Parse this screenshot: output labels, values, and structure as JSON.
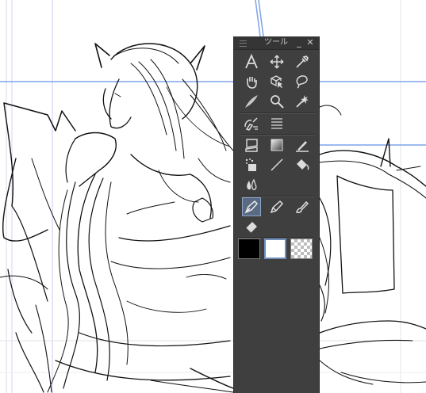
{
  "panel": {
    "title": "ツール",
    "minimize_label": "_",
    "close_label": "✕"
  },
  "tools": [
    {
      "name": "text-tool",
      "icon": "text-icon"
    },
    {
      "name": "move-tool",
      "icon": "move-arrows-icon"
    },
    {
      "name": "eyedropper-tool",
      "icon": "eyedropper-icon"
    },
    {
      "name": "hand-tool",
      "icon": "hand-icon"
    },
    {
      "name": "object-tool",
      "icon": "object-cube-icon"
    },
    {
      "name": "lasso-tool",
      "icon": "lasso-icon"
    },
    {
      "name": "ruler-tool",
      "icon": "ruler-icon"
    },
    {
      "name": "zoom-tool",
      "icon": "magnifier-icon"
    },
    {
      "name": "auto-select-tool",
      "icon": "magic-wand-icon"
    },
    {
      "name": "balloon-tool",
      "icon": "speech-pen-icon"
    },
    {
      "name": "speed-lines-tool",
      "icon": "parallel-lines-icon"
    },
    {
      "name": "frame-tool",
      "icon": "frame-border-icon"
    },
    {
      "name": "gradient-tool",
      "icon": "gradient-icon"
    },
    {
      "name": "correct-line-tool",
      "icon": "correct-line-icon"
    },
    {
      "name": "decoration-tool",
      "icon": "decoration-icon"
    },
    {
      "name": "figure-tool",
      "icon": "line-figure-icon"
    },
    {
      "name": "fill-tool",
      "icon": "bucket-fill-icon"
    },
    {
      "name": "blend-tool",
      "icon": "blend-drops-icon"
    },
    {
      "name": "pen-tool",
      "icon": "pen-nib-icon",
      "selected": true
    },
    {
      "name": "pencil-tool",
      "icon": "pencil-icon"
    },
    {
      "name": "brush-tool",
      "icon": "brush-icon"
    },
    {
      "name": "eraser-tool",
      "icon": "eraser-icon"
    }
  ],
  "colors": {
    "main": "#000000",
    "sub": "#ffffff",
    "panel_bg": "#3f3f3f",
    "guide": "#7fa3e8"
  }
}
